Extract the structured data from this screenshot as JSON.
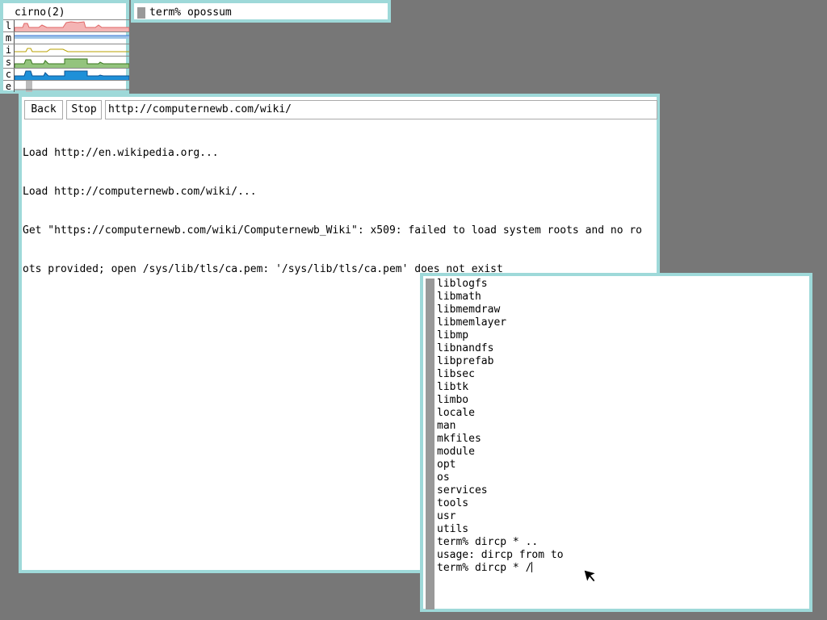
{
  "stats": {
    "title": "cirno(2)",
    "rows": [
      {
        "label": "l",
        "color": "#e06666",
        "fill": "#f4b4b4"
      },
      {
        "label": "m",
        "color": "#3c78d8",
        "fill": "#9fc5e8"
      },
      {
        "label": "i",
        "color": "#b8a000",
        "fill": "#ffe599"
      },
      {
        "label": "s",
        "color": "#38761d",
        "fill": "#93c47d"
      },
      {
        "label": "c",
        "color": "#0b5394",
        "fill": "#1e90d8"
      },
      {
        "label": "e",
        "color": "#666666",
        "fill": "#bbbbbb"
      }
    ]
  },
  "cmd": {
    "prompt_text": "term% opossum"
  },
  "browser": {
    "back_label": "Back",
    "stop_label": "Stop",
    "url": "http://computernewb.com/wiki/",
    "log": [
      "Load http://en.wikipedia.org...",
      "Load http://computernewb.com/wiki/...",
      "Get \"https://computernewb.com/wiki/Computernewb_Wiki\": x509: failed to load system roots and no ro",
      "ots provided; open /sys/lib/tls/ca.pem: '/sys/lib/tls/ca.pem' does not exist"
    ]
  },
  "terminal": {
    "lines": [
      "liblogfs",
      "libmath",
      "libmemdraw",
      "libmemlayer",
      "libmp",
      "libnandfs",
      "libprefab",
      "libsec",
      "libtk",
      "limbo",
      "locale",
      "man",
      "mkfiles",
      "module",
      "opt",
      "os",
      "services",
      "tools",
      "usr",
      "utils",
      "term% dircp * ..",
      "usage: dircp from to"
    ],
    "current_input": "term% dircp * /"
  }
}
